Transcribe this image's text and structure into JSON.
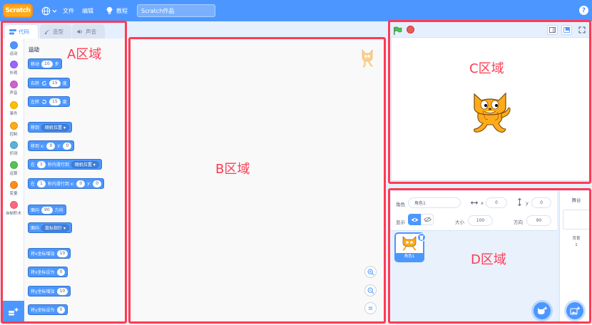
{
  "menubar": {
    "logo": "Scratch",
    "file": "文件",
    "edit": "编辑",
    "tutorials": "教程",
    "project_title": "Scratch作品"
  },
  "tabs": {
    "code": "代码",
    "costumes": "造型",
    "sounds": "声音"
  },
  "categories": [
    {
      "label": "运动",
      "color": "#4c97ff"
    },
    {
      "label": "外观",
      "color": "#9966ff"
    },
    {
      "label": "声音",
      "color": "#cf63cf"
    },
    {
      "label": "事件",
      "color": "#ffbf00"
    },
    {
      "label": "控制",
      "color": "#ffab19"
    },
    {
      "label": "侦测",
      "color": "#5cb1d6"
    },
    {
      "label": "运算",
      "color": "#59c059"
    },
    {
      "label": "变量",
      "color": "#ff8c1a"
    },
    {
      "label": "自制积木",
      "color": "#ff6680"
    }
  ],
  "palette": {
    "title": "运动",
    "move": {
      "pre": "移动",
      "val": "10",
      "post": "步"
    },
    "turn_right": {
      "pre": "右转",
      "val": "15",
      "post": "度"
    },
    "turn_left": {
      "pre": "左转",
      "val": "15",
      "post": "度"
    },
    "goto": {
      "pre": "移到",
      "dd": "随机位置"
    },
    "goto_xy": {
      "pre": "移到 x:",
      "x": "0",
      "mid": "y:",
      "y": "0"
    },
    "glide": {
      "pre": "在",
      "val": "1",
      "mid": "秒内滑行到",
      "dd": "随机位置"
    },
    "glide_xy": {
      "pre": "在",
      "val": "1",
      "mid": "秒内滑行到 x:",
      "x": "0",
      "mid2": "y:",
      "y": "0"
    },
    "point_dir": {
      "pre": "面向",
      "val": "90",
      "post": "方向"
    },
    "point_towards": {
      "pre": "面向",
      "dd": "鼠标指针"
    },
    "change_x": {
      "pre": "将x坐标增加",
      "val": "10"
    },
    "set_x": {
      "pre": "将x坐标设为",
      "val": "0"
    },
    "change_y": {
      "pre": "将y坐标增加",
      "val": "10"
    },
    "set_y": {
      "pre": "将y坐标设为",
      "val": "0"
    }
  },
  "sprite_info": {
    "sprite_label": "角色",
    "sprite_name": "角色1",
    "x_label": "x",
    "x_val": "0",
    "y_label": "y",
    "y_val": "0",
    "show_label": "显示",
    "size_label": "大小",
    "size_val": "100",
    "direction_label": "方向",
    "direction_val": "90"
  },
  "sprite_list": [
    {
      "name": "角色1"
    }
  ],
  "stage_target": {
    "title": "舞台",
    "backdrops_label": "背景",
    "backdrops_count": "1"
  },
  "annotations": {
    "a": "A区域",
    "b": "B区域",
    "c": "C区域",
    "d": "D区域",
    "color": "#ff3b52"
  }
}
